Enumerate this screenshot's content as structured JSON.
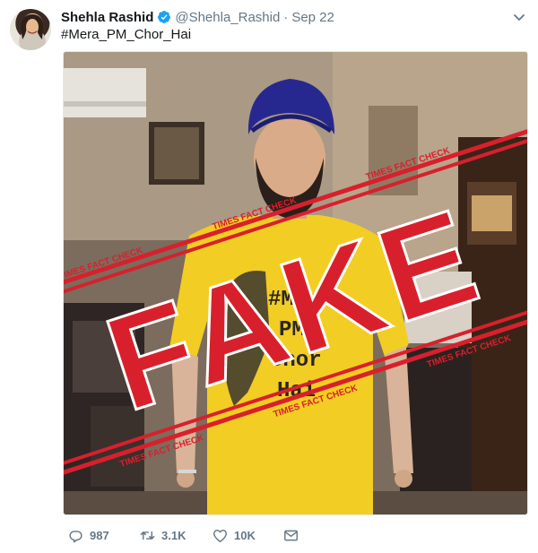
{
  "tweet": {
    "author_name": "Shehla Rashid",
    "handle": "@Shehla_Rashid",
    "separator": "·",
    "timestamp": "Sep 22",
    "text": "#Mera_PM_Chor_Hai"
  },
  "image": {
    "shirt_text": [
      "#Mera",
      "PM",
      "Chor",
      "Hai"
    ],
    "stamp_word": "FAKE",
    "stamp_band_text": "TIMES FACT CHECK",
    "stamp_color": "#d8202c",
    "turban_color": "#27288f",
    "shirt_color": "#f2cd23"
  },
  "actions": {
    "reply_count": "987",
    "retweet_count": "3.1K",
    "like_count": "10K"
  },
  "icons": {
    "verified": "verified-badge-icon",
    "caret": "chevron-down-icon",
    "reply": "reply-icon",
    "retweet": "retweet-icon",
    "like": "heart-icon",
    "message": "direct-message-icon"
  },
  "colors": {
    "verified_blue": "#1da1f2",
    "meta_gray": "#657786",
    "text": "#14171a"
  }
}
